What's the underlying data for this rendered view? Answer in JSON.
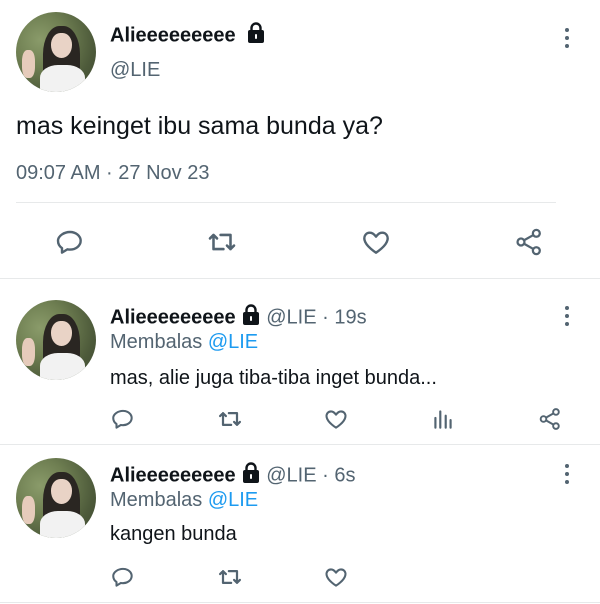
{
  "main_tweet": {
    "display_name": "Alieeeeeeeee",
    "handle": "@LIE",
    "text": "mas keinget ibu sama bunda ya?",
    "timestamp": "09:07 AM · 27 Nov 23",
    "actions": [
      "reply-icon",
      "retweet-icon",
      "like-icon",
      "share-icon"
    ]
  },
  "replies": [
    {
      "display_name": "Alieeeeeeeee",
      "handle": "@LIE",
      "time_ago": "· 19s",
      "replying_prefix": "Membalas",
      "replying_to": "@LIE",
      "text": "mas, alie juga tiba-tiba inget bunda...",
      "actions": [
        "reply-icon",
        "retweet-icon",
        "like-icon",
        "views-icon",
        "share-icon"
      ]
    },
    {
      "display_name": "Alieeeeeeeee",
      "handle": "@LIE",
      "time_ago": "· 6s",
      "replying_prefix": "Membalas",
      "replying_to": "@LIE",
      "text": "kangen bunda",
      "actions": [
        "reply-icon",
        "retweet-icon",
        "like-icon"
      ]
    }
  ],
  "colors": {
    "text": "#0f1419",
    "muted": "#536471",
    "link": "#1d9bf0",
    "divider": "#e7e9ea"
  }
}
